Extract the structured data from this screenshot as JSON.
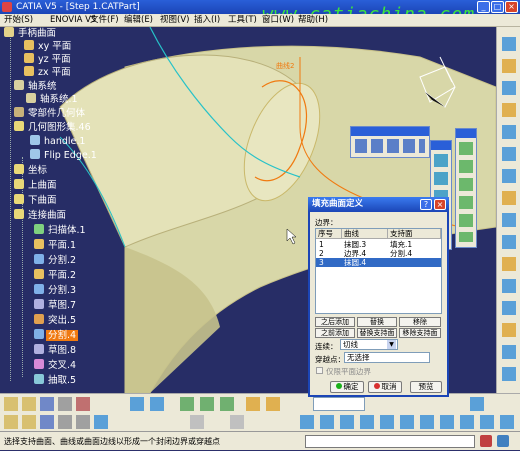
{
  "window": {
    "title": "CATIA V5 - [Step 1.CATPart]",
    "watermark": "www.catiachina.com"
  },
  "menu": [
    {
      "label": "开始(S)"
    },
    {
      "label": "ENOVIA V5"
    },
    {
      "label": "文件(F)"
    },
    {
      "label": "编辑(E)"
    },
    {
      "label": "视图(V)"
    },
    {
      "label": "插入(I)"
    },
    {
      "label": "工具(T)"
    },
    {
      "label": "窗口(W)"
    },
    {
      "label": "帮助(H)"
    }
  ],
  "tree": [
    {
      "label": "手柄曲面",
      "style": "plain",
      "icon": "part-icon"
    },
    {
      "label": "xy 平面",
      "style": "plain",
      "icon": "plane-icon"
    },
    {
      "label": "yz 平面",
      "style": "plain",
      "icon": "plane-icon"
    },
    {
      "label": "zx 平面",
      "style": "plain",
      "icon": "plane-icon"
    },
    {
      "label": "轴系统",
      "style": "plain",
      "icon": "axis-icon"
    },
    {
      "label": "轴系统.1",
      "style": "plain",
      "icon": "axis-icon"
    },
    {
      "label": "零部件几何体",
      "style": "plain",
      "icon": "body-icon"
    },
    {
      "label": "几何图形集.46",
      "style": "plain",
      "icon": "geoset-icon"
    },
    {
      "label": "handle.1",
      "style": "plain",
      "icon": "surface-icon"
    },
    {
      "label": "Flip Edge.1",
      "style": "plain",
      "icon": "surface-icon"
    },
    {
      "label": "坐标",
      "style": "plain",
      "icon": "geoset-icon"
    },
    {
      "label": "上曲面",
      "style": "plain",
      "icon": "geoset-icon"
    },
    {
      "label": "下曲面",
      "style": "plain",
      "icon": "geoset-icon"
    },
    {
      "label": "连接曲面",
      "style": "plain",
      "icon": "geoset-icon"
    },
    {
      "label": "扫描体.1",
      "style": "plain",
      "icon": "sweep-icon"
    },
    {
      "label": "平面.1",
      "style": "plain",
      "icon": "plane-icon"
    },
    {
      "label": "分割.2",
      "style": "plain",
      "icon": "split-icon"
    },
    {
      "label": "平面.2",
      "style": "plain",
      "icon": "plane-icon"
    },
    {
      "label": "分割.3",
      "style": "plain",
      "icon": "split-icon"
    },
    {
      "label": "草图.7",
      "style": "plain",
      "icon": "sketch-icon"
    },
    {
      "label": "突出.5",
      "style": "plain",
      "icon": "extrude-icon"
    },
    {
      "label": "分割.4",
      "style": "highlight-orange",
      "icon": "split-icon"
    },
    {
      "label": "草图.8",
      "style": "plain",
      "icon": "sketch-icon"
    },
    {
      "label": "交叉.4",
      "style": "plain",
      "icon": "intersect-icon"
    },
    {
      "label": "抽取.5",
      "style": "plain",
      "icon": "extract-icon"
    }
  ],
  "viewport": {
    "curve_label": "曲线2"
  },
  "dialog": {
    "title": "填充曲面定义",
    "boundary_label": "边界：",
    "columns": [
      "序号",
      "曲线",
      "支持面"
    ],
    "rows": [
      {
        "no": "1",
        "curve": "抹圆.3",
        "support": "填充.1"
      },
      {
        "no": "2",
        "curve": "边界.4",
        "support": "分割.4"
      },
      {
        "no": "3",
        "curve": "抹圆.4",
        "support": ""
      }
    ],
    "buttons": {
      "add_after": "之后添加",
      "replace": "替换",
      "remove": "移除",
      "add_before": "之前添加",
      "replace_support": "替换支持面",
      "remove_support": "移除支持面"
    },
    "continuity_label": "连续：",
    "continuity_value": "切线",
    "pass_point_label": "穿越点：",
    "pass_point_value": "无选择",
    "planar_boundary": "仅限平面边界",
    "ok": "确定",
    "cancel": "取消",
    "preview": "预览"
  },
  "status": {
    "message": "选择支持曲面、曲线或曲面边线以形成一个封闭边界或穿越点"
  },
  "colors": {
    "viewport_bg": "#272d66",
    "surface_fill": "#d8d7a8",
    "highlight": "#f07a10",
    "selection": "#316ac5"
  }
}
